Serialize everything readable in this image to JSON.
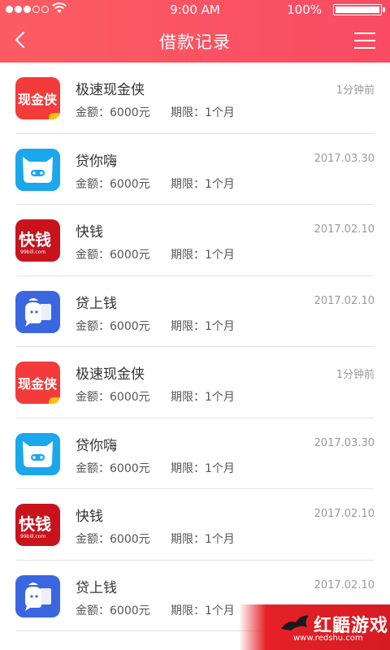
{
  "status_bar": {
    "time": "9:00 AM",
    "battery_percent": "100%",
    "signal_bars_filled": 3,
    "signal_bars_total": 5,
    "battery_level": 1.0
  },
  "header": {
    "title": "借款记录",
    "back_icon": "chevron-left-icon",
    "menu_icon": "hamburger-menu-icon",
    "brand_color": "#fb5c63"
  },
  "labels": {
    "amount_prefix": "金额：",
    "term_prefix": "期限："
  },
  "loans": [
    {
      "name": "极速现金侠",
      "date": "1分钟前",
      "amount": "6000元",
      "term": "1个月",
      "icon": "jisu",
      "icon_text": "现金侠"
    },
    {
      "name": "贷你嗨",
      "date": "2017.03.30",
      "amount": "6000元",
      "term": "1个月",
      "icon": "dai",
      "icon_text": ""
    },
    {
      "name": "快钱",
      "date": "2017.02.10",
      "amount": "6000元",
      "term": "1个月",
      "icon": "kuai",
      "icon_text": "快钱",
      "icon_sub": "99bill.com"
    },
    {
      "name": "贷上钱",
      "date": "2017.02.10",
      "amount": "6000元",
      "term": "1个月",
      "icon": "dsq",
      "icon_text": ""
    },
    {
      "name": "极速现金侠",
      "date": "1分钟前",
      "amount": "6000元",
      "term": "1个月",
      "icon": "jisu",
      "icon_text": "现金侠"
    },
    {
      "name": "贷你嗨",
      "date": "2017.03.30",
      "amount": "6000元",
      "term": "1个月",
      "icon": "dai",
      "icon_text": ""
    },
    {
      "name": "快钱",
      "date": "2017.02.10",
      "amount": "6000元",
      "term": "1个月",
      "icon": "kuai",
      "icon_text": "快钱",
      "icon_sub": "99bill.com"
    },
    {
      "name": "贷上钱",
      "date": "2017.02.10",
      "amount": "6000元",
      "term": "1个月",
      "icon": "dsq",
      "icon_text": ""
    }
  ],
  "watermark": {
    "text": "红鼯游戏",
    "url": "www.redshu.com"
  }
}
